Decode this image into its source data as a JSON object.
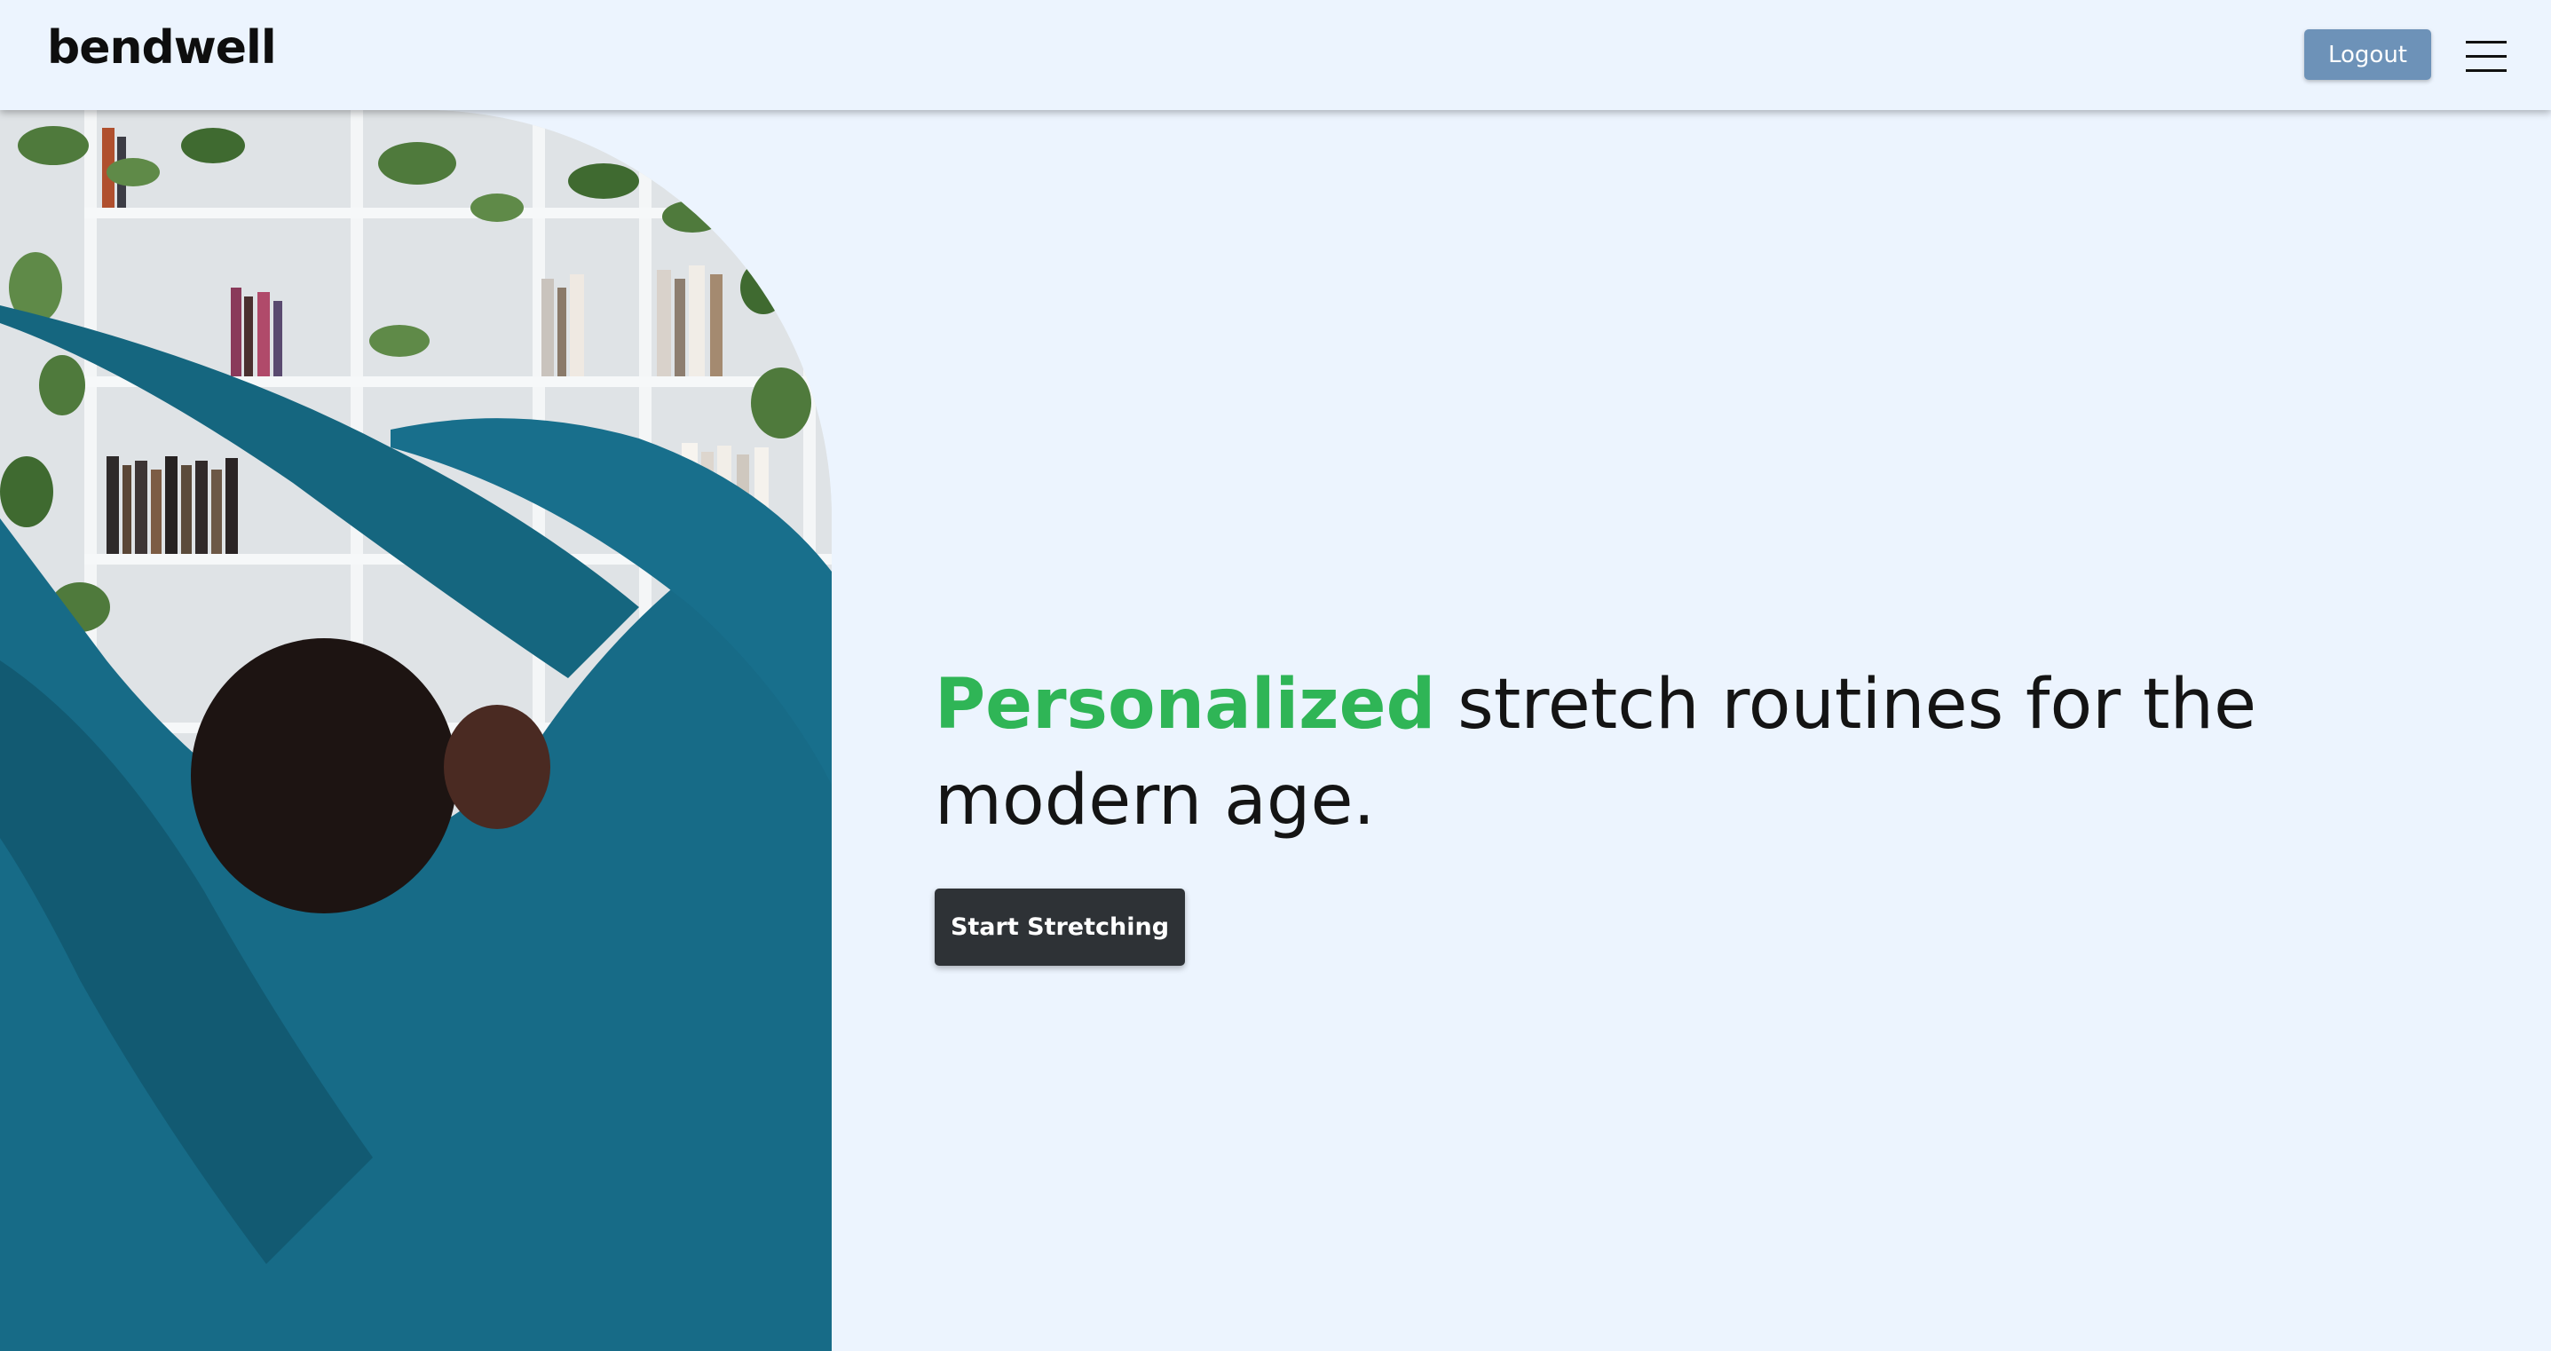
{
  "header": {
    "logo": "bendwell",
    "logout_label": "Logout",
    "menu_icon": "hamburger-menu-icon"
  },
  "hero": {
    "image_description": "person stretching in front of bookshelves",
    "headline_accent": "Personalized",
    "headline_rest": " stretch routines for the modern age.",
    "cta_label": "Start Stretching"
  },
  "colors": {
    "background": "#ecf4fe",
    "accent_green": "#2fb556",
    "logout_button": "#6d92b8",
    "cta_button": "#2e3236"
  }
}
